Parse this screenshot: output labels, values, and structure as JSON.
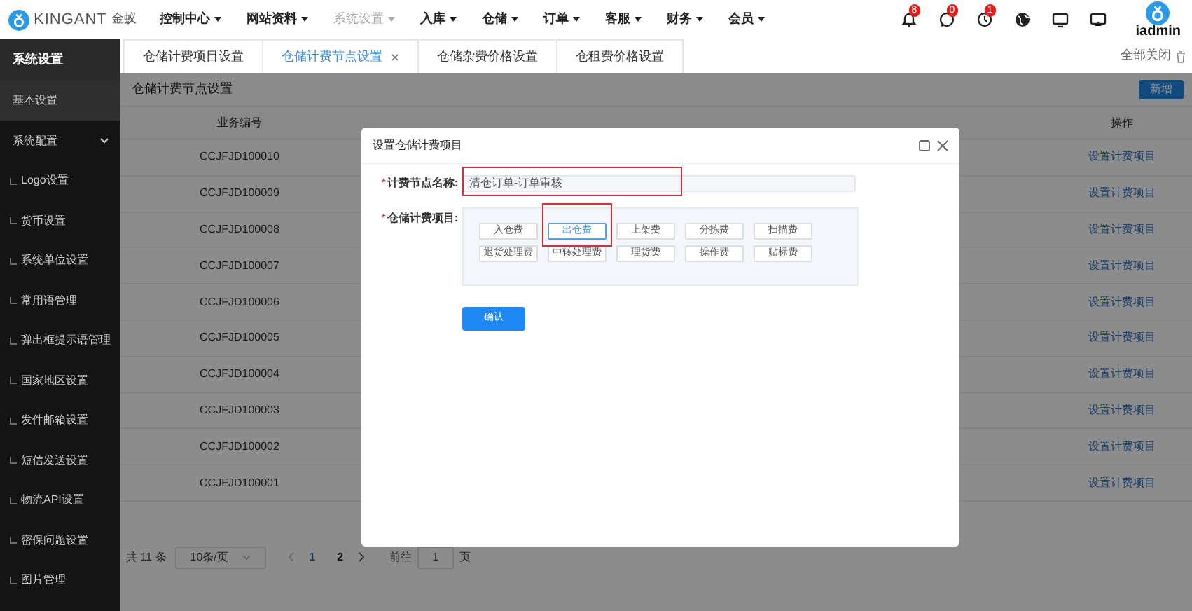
{
  "header": {
    "logo_text": "KINGANT",
    "logo_sub": "金蚁",
    "menus": [
      {
        "label": "控制中心",
        "selected": false
      },
      {
        "label": "网站资料",
        "selected": false
      },
      {
        "label": "系统设置",
        "selected": true
      },
      {
        "label": "入库",
        "selected": false
      },
      {
        "label": "仓储",
        "selected": false
      },
      {
        "label": "订单",
        "selected": false
      },
      {
        "label": "客服",
        "selected": false
      },
      {
        "label": "财务",
        "selected": false
      },
      {
        "label": "会员",
        "selected": false
      }
    ],
    "notifications": [
      {
        "kind": "bell",
        "badge": "8"
      },
      {
        "kind": "chat",
        "badge": "0"
      },
      {
        "kind": "clock",
        "badge": "1"
      }
    ],
    "tools": [
      {
        "kind": "globe"
      },
      {
        "kind": "monitor"
      },
      {
        "kind": "cast"
      }
    ],
    "user": "iadmin"
  },
  "sidebar": {
    "title": "系统设置",
    "items": [
      {
        "label": "基本设置",
        "selected": true
      },
      {
        "label": "系统配置",
        "selected": false,
        "expanded": true,
        "children": [
          {
            "label": "Logo设置",
            "selected": false
          },
          {
            "label": "货币设置",
            "selected": false
          },
          {
            "label": "系统单位设置",
            "selected": false
          },
          {
            "label": "常用语管理",
            "selected": false
          },
          {
            "label": "弹出框提示语管理",
            "selected": false
          },
          {
            "label": "国家地区设置",
            "selected": false
          },
          {
            "label": "发件邮箱设置",
            "selected": false
          },
          {
            "label": "短信发送设置",
            "selected": false
          },
          {
            "label": "物流API设置",
            "selected": false
          },
          {
            "label": "密保问题设置",
            "selected": false
          },
          {
            "label": "图片管理",
            "selected": false
          }
        ]
      }
    ]
  },
  "tabs": [
    {
      "label": "仓储计费项目设置",
      "selected": false
    },
    {
      "label": "仓储计费节点设置",
      "selected": true
    },
    {
      "label": "仓储杂费价格设置",
      "selected": false
    },
    {
      "label": "仓租费价格设置",
      "selected": false
    }
  ],
  "close_all": "全部关闭",
  "page": {
    "title": "仓储计费节点设置",
    "add_button": "新增",
    "table": {
      "columns": [
        "业务编号",
        "操作"
      ],
      "rows": [
        {
          "id": "CCJFJD100010",
          "action": "设置计费项目"
        },
        {
          "id": "CCJFJD100009",
          "action": "设置计费项目"
        },
        {
          "id": "CCJFJD100008",
          "action": "设置计费项目"
        },
        {
          "id": "CCJFJD100007",
          "action": "设置计费项目"
        },
        {
          "id": "CCJFJD100006",
          "action": "设置计费项目"
        },
        {
          "id": "CCJFJD100005",
          "action": "设置计费项目"
        },
        {
          "id": "CCJFJD100004",
          "action": "设置计费项目"
        },
        {
          "id": "CCJFJD100003",
          "action": "设置计费项目"
        },
        {
          "id": "CCJFJD100002",
          "action": "设置计费项目"
        },
        {
          "id": "CCJFJD100001",
          "action": "设置计费项目"
        }
      ]
    },
    "pagination": {
      "total": "共 11 条",
      "page_size": "10条/页",
      "pages": [
        {
          "label": "1",
          "selected": true
        },
        {
          "label": "2",
          "selected": false
        }
      ],
      "goto_label": "前往",
      "goto_value": "1",
      "goto_suffix": "页"
    }
  },
  "modal": {
    "title": "设置仓储计费项目",
    "name_field": {
      "mark": "*",
      "label": "计费节点名称:",
      "value": "清仓订单-订单审核"
    },
    "items_field": {
      "mark": "*",
      "label": "仓储计费项目:",
      "options": [
        {
          "label": "入仓费",
          "selected": false
        },
        {
          "label": "出仓费",
          "selected": true
        },
        {
          "label": "上架费",
          "selected": false
        },
        {
          "label": "分拣费",
          "selected": false
        },
        {
          "label": "扫描费",
          "selected": false
        },
        {
          "label": "退货处理费",
          "selected": false
        },
        {
          "label": "中转处理费",
          "selected": false
        },
        {
          "label": "理货费",
          "selected": false
        },
        {
          "label": "操作费",
          "selected": false
        },
        {
          "label": "贴标费",
          "selected": false
        }
      ]
    },
    "confirm": "确认"
  }
}
